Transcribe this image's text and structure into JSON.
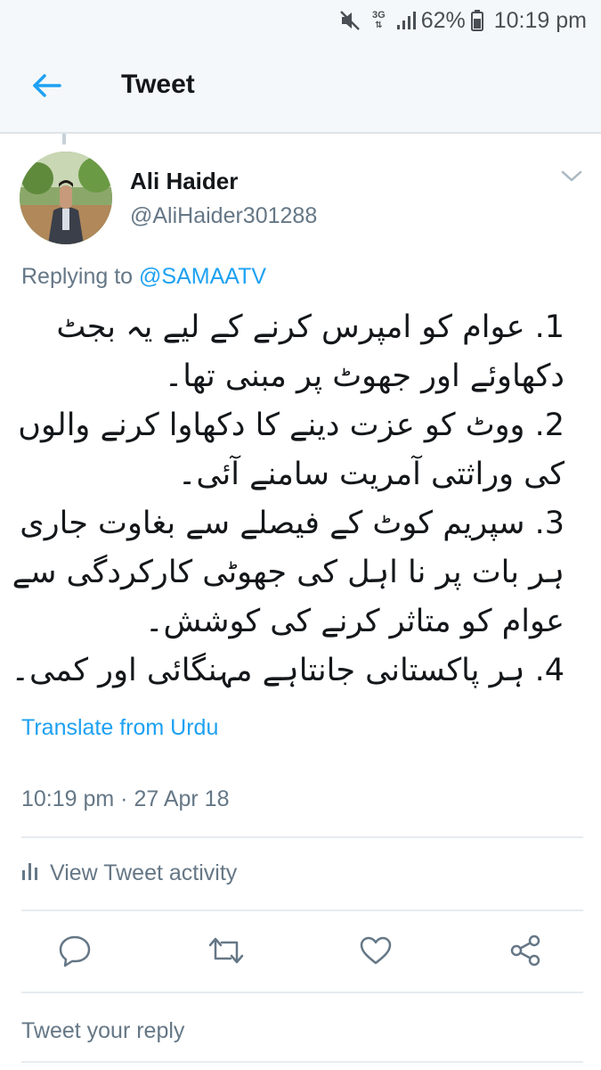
{
  "status_bar": {
    "network": "3G",
    "battery": "62%",
    "time": "10:19 pm",
    "icons": [
      "mute-icon",
      "network-3g-icon",
      "signal-icon",
      "battery-icon"
    ]
  },
  "header": {
    "back_icon": "back-arrow-icon",
    "title": "Tweet"
  },
  "tweet": {
    "author": {
      "display_name": "Ali Haider",
      "handle": "@AliHaider301288",
      "avatar_icon": "avatar"
    },
    "caret_icon": "chevron-down-icon",
    "replying_prefix": "Replying to",
    "replying_to": "@SAMAATV",
    "text_lines": [
      "1. عوام کو امپرس کرنے کے لیے یہ بجٹ",
      "دکھاوئے اور جھوٹ پر مبنی تھا۔",
      "2. ووٹ کو عزت دینے کا دکھاوا کرنے والوں",
      "کی وراثتی آمریت سامنے آئی۔",
      "3. سپریم کوٹ کے فیصلے سے بغاوت جاری",
      "ہر بات پر نا اہل کی جھوٹی کارکردگی سے",
      "عوام کو متاثر کرنے کی کوشش۔",
      "4. ہر پاکستانی جانتاہے مہنگائی اور کمی۔"
    ],
    "translate_label": "Translate from Urdu",
    "timestamp": "10:19 pm · 27 Apr 18"
  },
  "activity": {
    "icon": "bar-chart-icon",
    "label": "View Tweet activity"
  },
  "actions": [
    {
      "name": "reply",
      "icon": "reply-icon"
    },
    {
      "name": "retweet",
      "icon": "retweet-icon"
    },
    {
      "name": "like",
      "icon": "heart-icon"
    },
    {
      "name": "share",
      "icon": "share-icon"
    }
  ],
  "reply_input": {
    "placeholder": "Tweet your reply"
  },
  "colors": {
    "accent": "#1da1f2",
    "muted_text": "#657786",
    "primary_text": "#14171a",
    "header_bg": "#f5f8fa",
    "divider": "#e6ecf0"
  }
}
